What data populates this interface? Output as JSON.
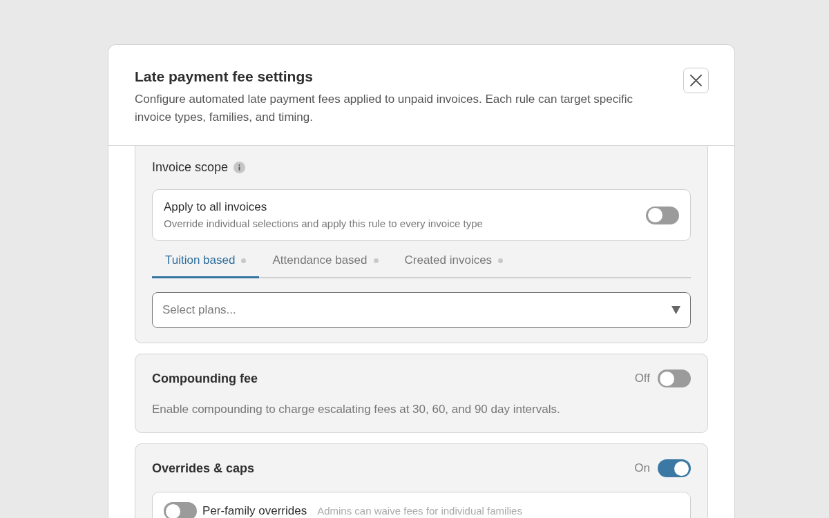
{
  "dialog": {
    "title": "Late payment fee settings",
    "description": "Configure automated late payment fees applied to unpaid invoices. Each rule can target specific invoice types, families, and timing."
  },
  "invoice_scope": {
    "title": "Invoice scope",
    "apply_all": {
      "title": "Apply to all invoices",
      "description": "Override individual selections and apply this rule to every invoice type",
      "on": false
    },
    "tabs": [
      {
        "label": "Tuition based",
        "selected": true
      },
      {
        "label": "Attendance based",
        "selected": false
      },
      {
        "label": "Created invoices",
        "selected": false
      }
    ],
    "select": {
      "placeholder": "Select plans..."
    }
  },
  "compounding": {
    "title": "Compounding fee",
    "state_label": "Off",
    "on": false,
    "description": "Enable compounding to charge escalating fees at 30, 60, and 90 day intervals."
  },
  "overrides": {
    "title": "Overrides & caps",
    "state_label": "On",
    "on": true,
    "options": [
      {
        "title": "Per-family overrides",
        "description": "Admins can waive fees for individual families",
        "on": false
      }
    ]
  }
}
